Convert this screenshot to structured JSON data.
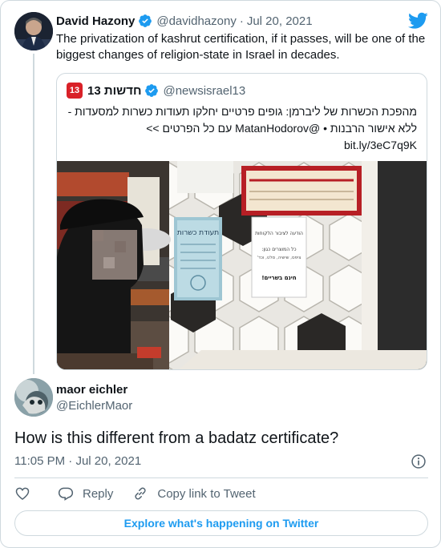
{
  "colors": {
    "accent": "#1d9bf0",
    "secondary_text": "#536471",
    "border": "#cfd9de",
    "brand_13": "#d92128"
  },
  "tweet": {
    "author_name": "David Hazony",
    "author_handle": "@davidhazony",
    "separator": "·",
    "date": "Jul 20, 2021",
    "text": "The privatization of kashrut certification, if it passes, will be one of the biggest changes of religion-state in Israel in decades."
  },
  "quoted_tweet": {
    "logo_text": "13",
    "author_name": "חדשות 13",
    "author_handle": "@newsisrael13",
    "text": "מהפכת הכשרות של ליברמן: גופים פרטיים יחלקו תעודות כשרות למסעדות - ללא אישור הרבנות • @MatanHodorov עם כל הפרטים >>",
    "link": "bit.ly/3eC7q9K",
    "photo_notice_title": "הודעה לציבור הלקוחות",
    "photo_notice_line1": "כל המוצרים כגון:",
    "photo_notice_line2": "ציפס, שישיה, סלט, וכד'",
    "photo_notice_bottom": "חינם בשריים!",
    "photo_certificate_title": "תעודת כשרות"
  },
  "reply": {
    "author_name": "maor eichler",
    "author_handle": "@EichlerMaor",
    "text": "How is this different from a badatz certificate?",
    "time": "11:05 PM",
    "separator": "·",
    "date": "Jul 20, 2021"
  },
  "actions": {
    "reply_label": "Reply",
    "copy_link_label": "Copy link to Tweet"
  },
  "explore_button_label": "Explore what's happening on Twitter",
  "icons": [
    "verified-badge-icon",
    "twitter-bird-icon",
    "info-icon",
    "heart-icon",
    "reply-bubble-icon",
    "link-icon"
  ]
}
